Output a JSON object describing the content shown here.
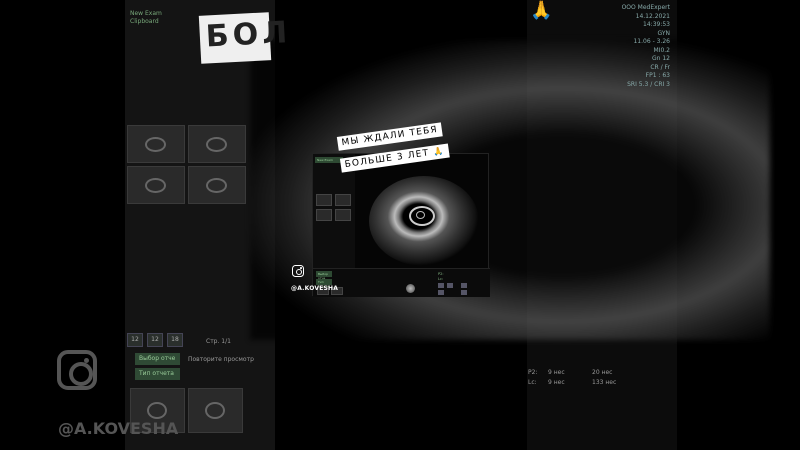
{
  "caption": {
    "line1": "МЫ ЖДАЛИ ТЕБЯ",
    "line2": "БОЛЬШЕ 3 ЛЕТ",
    "emoji": "🙏"
  },
  "watermark": {
    "handle": "@A.KOVESHA",
    "icon": "instagram-icon"
  },
  "background": {
    "big_text": "БОЛ",
    "header_left_1": "New Exam",
    "header_left_2": "Clipboard",
    "clinic_name": "ООО MedExpert",
    "date": "14.12.2021",
    "time": "14:39:53",
    "right_info": [
      "GYN",
      "11.06 - 3.26",
      "MI0.2",
      "Gn 12",
      "CR / Fr",
      "FP1 : 63",
      "SRI 5.3 / CRI 3"
    ],
    "page_label": "Стр. 1/1",
    "buttons": [
      "12",
      "12",
      "18"
    ],
    "tab_1": "Выбор отче",
    "tab_2": "Повторите просмотр",
    "tab_3": "Тип отчета",
    "p2_label": "P2:",
    "p2_value": "9 нес",
    "p2_num": "20 нес",
    "lc_label": "Lc:",
    "lc_value": "9 нес",
    "lc_num": "133 нес"
  },
  "colors": {
    "caption_bg": "#ffffff",
    "caption_text": "#000000",
    "panel_green": "#2f4a35",
    "info_text": "#8aa8a8"
  }
}
